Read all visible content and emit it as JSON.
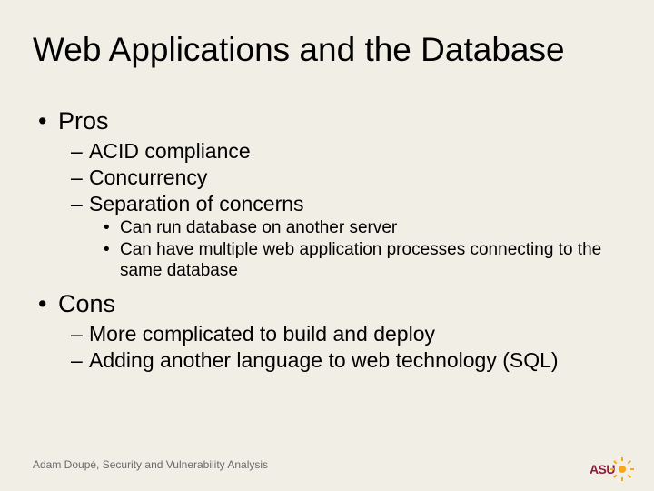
{
  "title": "Web Applications and the Database",
  "pros_label": "Pros",
  "pros": {
    "p1": "ACID compliance",
    "p2": "Concurrency",
    "p3": "Separation of concerns",
    "sub1": "Can run database on another server",
    "sub2": "Can have multiple web application processes connecting to the same database"
  },
  "cons_label": "Cons",
  "cons": {
    "c1": "More complicated to build and deploy",
    "c2": "Adding another language to web technology (SQL)"
  },
  "footer": "Adam Doupé, Security and Vulnerability Analysis",
  "logo_text": "ASU"
}
